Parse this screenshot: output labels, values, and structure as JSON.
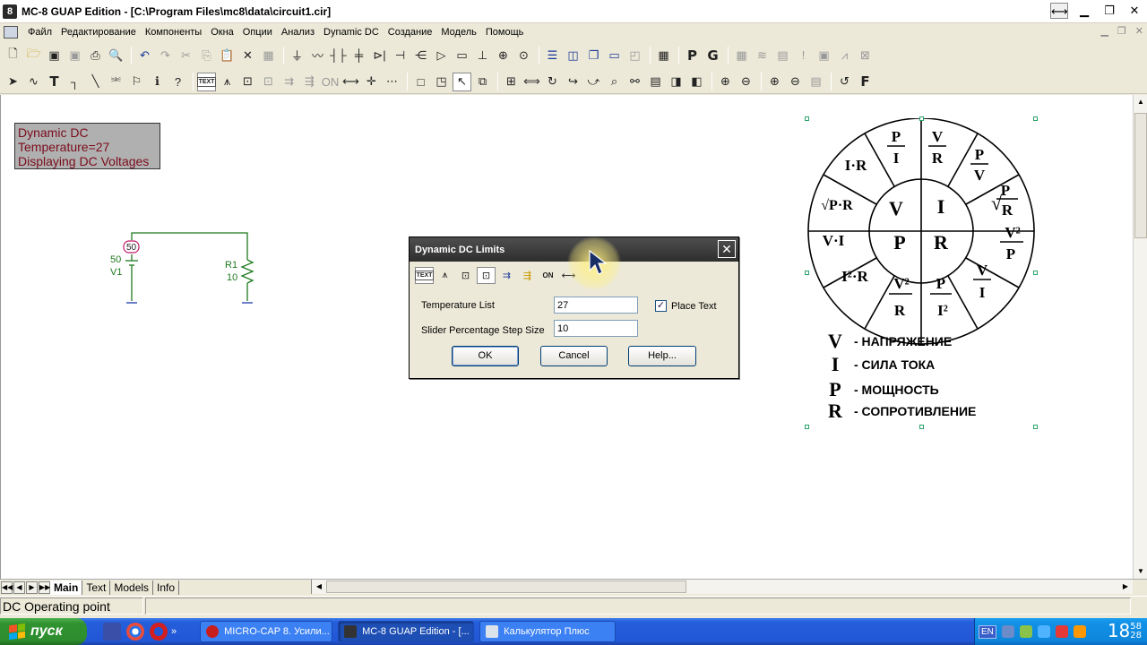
{
  "window": {
    "title": "MC-8 GUAP Edition - [C:\\Program Files\\mc8\\data\\circuit1.cir]",
    "app_icon": "8"
  },
  "menu": [
    {
      "label": "Файл"
    },
    {
      "label": "Редактирование"
    },
    {
      "label": "Компоненты"
    },
    {
      "label": "Окна"
    },
    {
      "label": "Опции"
    },
    {
      "label": "Анализ"
    },
    {
      "label": "Dynamic DC"
    },
    {
      "label": "Создание"
    },
    {
      "label": "Модель"
    },
    {
      "label": "Помощь"
    }
  ],
  "toolbar2": {
    "text_tool_label": "TEXT",
    "p_label": "P",
    "g_label": "G",
    "f_label": "F"
  },
  "info_box": {
    "line1": "Dynamic DC",
    "line2": "Temperature=27",
    "line3": "Displaying DC Voltages"
  },
  "circuit": {
    "v1_value_tag": "50",
    "v1_value": "50",
    "v1_name": "V1",
    "r1_name": "R1",
    "r1_value": "10"
  },
  "dialog": {
    "title": "Dynamic DC Limits",
    "toolbar_text_label": "TEXT",
    "temperature_label": "Temperature List",
    "temperature_value": "27",
    "slider_label": "Slider Percentage Step Size",
    "slider_value": "10",
    "place_text_label": "Place Text",
    "place_text_checked": true,
    "ok_label": "OK",
    "cancel_label": "Cancel",
    "help_label": "Help..."
  },
  "wheel": {
    "inner": [
      "V",
      "I",
      "R",
      "P"
    ],
    "legend": [
      {
        "symbol": "V",
        "text": "- НАПРЯЖЕНИЕ"
      },
      {
        "symbol": "I",
        "text": "- СИЛА ТОКА"
      },
      {
        "symbol": "P",
        "text": "- МОЩНОСТЬ"
      },
      {
        "symbol": "R",
        "text": "- СОПРОТИВЛЕНИЕ"
      }
    ]
  },
  "tabs": [
    {
      "label": "Main",
      "active": true
    },
    {
      "label": "Text"
    },
    {
      "label": "Models"
    },
    {
      "label": "Info"
    }
  ],
  "status": {
    "text": "DC Operating point"
  },
  "taskbar": {
    "start_label": "пуск",
    "tasks": [
      {
        "label": "MICRO-CAP 8. Усили...",
        "icon_color": "#c81e1e"
      },
      {
        "label": "MC-8 GUAP Edition - [...",
        "icon_color": "#333333",
        "active": true
      },
      {
        "label": "Калькулятор Плюс",
        "icon_color": "#dde3ea"
      }
    ],
    "lang": "EN",
    "clock": "18",
    "clock_minutes": "58",
    "clock_seconds": "28"
  },
  "colors": {
    "info_box_text": "#7a0d1c",
    "wire_green": "#1f7a1f",
    "ground_blue": "#1c3aa8",
    "taskbar_blue": "#245edb",
    "start_green": "#2f922f"
  }
}
